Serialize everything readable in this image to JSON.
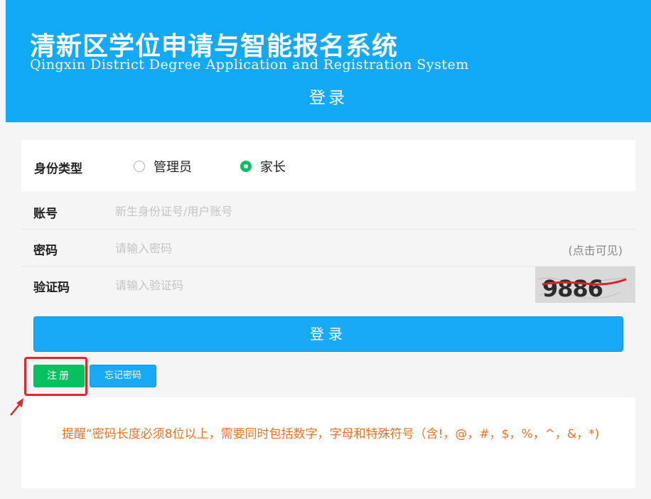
{
  "header": {
    "title_cn": "清新区学位申请与智能报名系统",
    "title_en": "Qingxin District Degree Application and Registration System",
    "subtitle": "登录",
    "bg_color": "#12aaf7"
  },
  "identity": {
    "label": "身份类型",
    "options": [
      {
        "label": "管理员",
        "checked": false
      },
      {
        "label": "家长",
        "checked": true
      }
    ],
    "accent_color": "#07c160"
  },
  "form": {
    "account": {
      "label": "账号",
      "placeholder": "新生身份证号/用户账号",
      "value": ""
    },
    "password": {
      "label": "密码",
      "placeholder": "请输入密码",
      "value": "",
      "toggle_label": "(点击可见)"
    },
    "captcha": {
      "label": "验证码",
      "placeholder": "请输入验证码",
      "value": "",
      "image_text": "9886"
    }
  },
  "actions": {
    "login_label": "登录",
    "register_label": "注册",
    "forgot_label": "忘记密码",
    "primary_color": "#18a9f7",
    "annotation_color": "#e0272b"
  },
  "notice": {
    "text": "提醒“密码长度必须8位以上，需要同时包括数字，字母和特殊符号（含!，@，#，$，%，^，&，*)"
  }
}
